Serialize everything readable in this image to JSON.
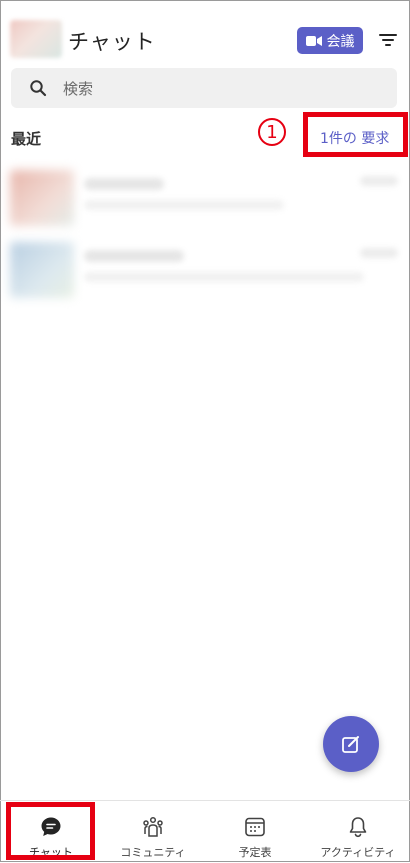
{
  "header": {
    "title": "チャット",
    "meet_label": "会議",
    "meet_icon": "video-camera-icon",
    "filter_icon": "filter-icon",
    "accent": "#5b5fc7"
  },
  "search": {
    "placeholder": "検索",
    "icon": "search-icon"
  },
  "recent": {
    "label": "最近",
    "requests_link": "1件の 要求",
    "annotation_marker": "1",
    "annotation_color": "#e60012"
  },
  "fab": {
    "icon": "compose-icon"
  },
  "bottom_nav": {
    "items": [
      {
        "label": "チャット",
        "icon": "chat-icon",
        "active": true
      },
      {
        "label": "コミュニティ",
        "icon": "community-icon",
        "active": false
      },
      {
        "label": "予定表",
        "icon": "calendar-icon",
        "active": false
      },
      {
        "label": "アクティビティ",
        "icon": "bell-icon",
        "active": false
      }
    ]
  }
}
